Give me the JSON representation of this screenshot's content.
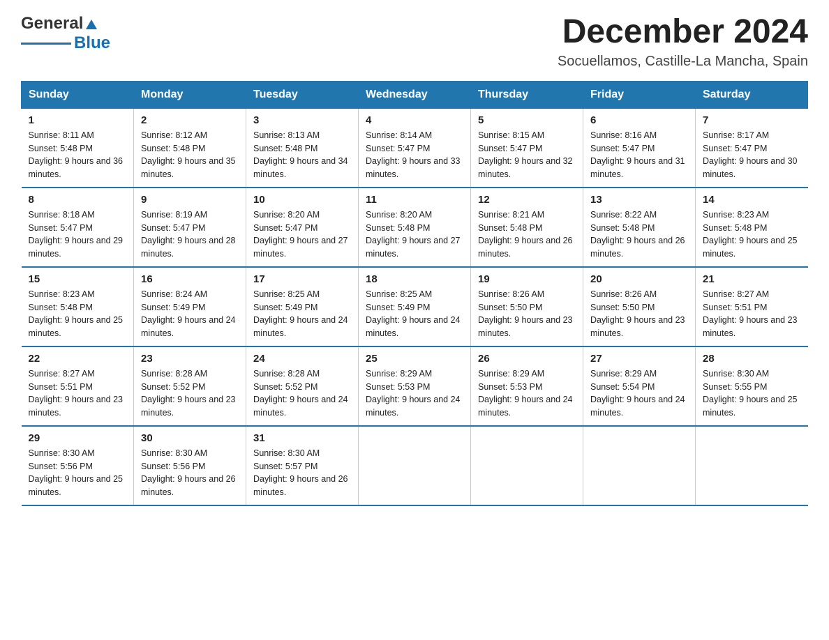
{
  "header": {
    "logo_general": "General",
    "logo_blue": "Blue",
    "month_title": "December 2024",
    "location": "Socuellamos, Castille-La Mancha, Spain"
  },
  "weekdays": [
    "Sunday",
    "Monday",
    "Tuesday",
    "Wednesday",
    "Thursday",
    "Friday",
    "Saturday"
  ],
  "weeks": [
    [
      {
        "day": "1",
        "sunrise": "8:11 AM",
        "sunset": "5:48 PM",
        "daylight": "9 hours and 36 minutes."
      },
      {
        "day": "2",
        "sunrise": "8:12 AM",
        "sunset": "5:48 PM",
        "daylight": "9 hours and 35 minutes."
      },
      {
        "day": "3",
        "sunrise": "8:13 AM",
        "sunset": "5:48 PM",
        "daylight": "9 hours and 34 minutes."
      },
      {
        "day": "4",
        "sunrise": "8:14 AM",
        "sunset": "5:47 PM",
        "daylight": "9 hours and 33 minutes."
      },
      {
        "day": "5",
        "sunrise": "8:15 AM",
        "sunset": "5:47 PM",
        "daylight": "9 hours and 32 minutes."
      },
      {
        "day": "6",
        "sunrise": "8:16 AM",
        "sunset": "5:47 PM",
        "daylight": "9 hours and 31 minutes."
      },
      {
        "day": "7",
        "sunrise": "8:17 AM",
        "sunset": "5:47 PM",
        "daylight": "9 hours and 30 minutes."
      }
    ],
    [
      {
        "day": "8",
        "sunrise": "8:18 AM",
        "sunset": "5:47 PM",
        "daylight": "9 hours and 29 minutes."
      },
      {
        "day": "9",
        "sunrise": "8:19 AM",
        "sunset": "5:47 PM",
        "daylight": "9 hours and 28 minutes."
      },
      {
        "day": "10",
        "sunrise": "8:20 AM",
        "sunset": "5:47 PM",
        "daylight": "9 hours and 27 minutes."
      },
      {
        "day": "11",
        "sunrise": "8:20 AM",
        "sunset": "5:48 PM",
        "daylight": "9 hours and 27 minutes."
      },
      {
        "day": "12",
        "sunrise": "8:21 AM",
        "sunset": "5:48 PM",
        "daylight": "9 hours and 26 minutes."
      },
      {
        "day": "13",
        "sunrise": "8:22 AM",
        "sunset": "5:48 PM",
        "daylight": "9 hours and 26 minutes."
      },
      {
        "day": "14",
        "sunrise": "8:23 AM",
        "sunset": "5:48 PM",
        "daylight": "9 hours and 25 minutes."
      }
    ],
    [
      {
        "day": "15",
        "sunrise": "8:23 AM",
        "sunset": "5:48 PM",
        "daylight": "9 hours and 25 minutes."
      },
      {
        "day": "16",
        "sunrise": "8:24 AM",
        "sunset": "5:49 PM",
        "daylight": "9 hours and 24 minutes."
      },
      {
        "day": "17",
        "sunrise": "8:25 AM",
        "sunset": "5:49 PM",
        "daylight": "9 hours and 24 minutes."
      },
      {
        "day": "18",
        "sunrise": "8:25 AM",
        "sunset": "5:49 PM",
        "daylight": "9 hours and 24 minutes."
      },
      {
        "day": "19",
        "sunrise": "8:26 AM",
        "sunset": "5:50 PM",
        "daylight": "9 hours and 23 minutes."
      },
      {
        "day": "20",
        "sunrise": "8:26 AM",
        "sunset": "5:50 PM",
        "daylight": "9 hours and 23 minutes."
      },
      {
        "day": "21",
        "sunrise": "8:27 AM",
        "sunset": "5:51 PM",
        "daylight": "9 hours and 23 minutes."
      }
    ],
    [
      {
        "day": "22",
        "sunrise": "8:27 AM",
        "sunset": "5:51 PM",
        "daylight": "9 hours and 23 minutes."
      },
      {
        "day": "23",
        "sunrise": "8:28 AM",
        "sunset": "5:52 PM",
        "daylight": "9 hours and 23 minutes."
      },
      {
        "day": "24",
        "sunrise": "8:28 AM",
        "sunset": "5:52 PM",
        "daylight": "9 hours and 24 minutes."
      },
      {
        "day": "25",
        "sunrise": "8:29 AM",
        "sunset": "5:53 PM",
        "daylight": "9 hours and 24 minutes."
      },
      {
        "day": "26",
        "sunrise": "8:29 AM",
        "sunset": "5:53 PM",
        "daylight": "9 hours and 24 minutes."
      },
      {
        "day": "27",
        "sunrise": "8:29 AM",
        "sunset": "5:54 PM",
        "daylight": "9 hours and 24 minutes."
      },
      {
        "day": "28",
        "sunrise": "8:30 AM",
        "sunset": "5:55 PM",
        "daylight": "9 hours and 25 minutes."
      }
    ],
    [
      {
        "day": "29",
        "sunrise": "8:30 AM",
        "sunset": "5:56 PM",
        "daylight": "9 hours and 25 minutes."
      },
      {
        "day": "30",
        "sunrise": "8:30 AM",
        "sunset": "5:56 PM",
        "daylight": "9 hours and 26 minutes."
      },
      {
        "day": "31",
        "sunrise": "8:30 AM",
        "sunset": "5:57 PM",
        "daylight": "9 hours and 26 minutes."
      },
      {
        "day": "",
        "sunrise": "",
        "sunset": "",
        "daylight": ""
      },
      {
        "day": "",
        "sunrise": "",
        "sunset": "",
        "daylight": ""
      },
      {
        "day": "",
        "sunrise": "",
        "sunset": "",
        "daylight": ""
      },
      {
        "day": "",
        "sunrise": "",
        "sunset": "",
        "daylight": ""
      }
    ]
  ]
}
